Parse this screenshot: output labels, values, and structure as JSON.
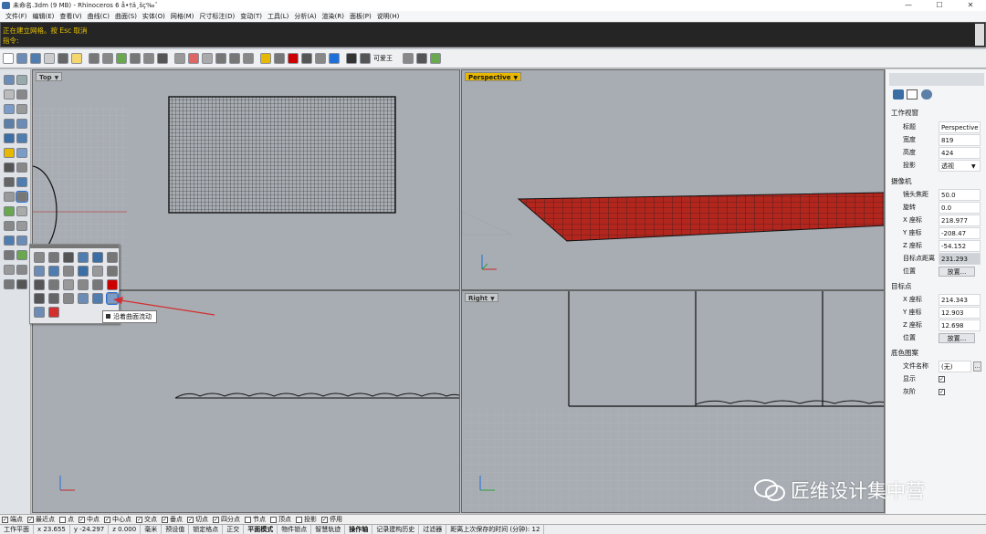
{
  "window": {
    "title": "未命名.3dm (9 MB) - Rhinoceros 6 å•†ä¸šç‰ˆ",
    "min": "—",
    "max": "☐",
    "close": "✕"
  },
  "menu": [
    "文件(F)",
    "编辑(E)",
    "查看(V)",
    "曲线(C)",
    "曲面(S)",
    "实体(O)",
    "网格(M)",
    "尺寸标注(D)",
    "变动(T)",
    "工具(L)",
    "分析(A)",
    "渲染(R)",
    "面板(P)",
    "说明(H)"
  ],
  "command": {
    "history": "正在建立网格。按 Esc 取消",
    "prompt": "指令:"
  },
  "toolbar": {
    "named_label": "可爱王"
  },
  "viewports": {
    "top": "Top",
    "perspective": "Perspective",
    "right": "Right"
  },
  "flyout_tooltip": "沿着曲面流动",
  "panel": {
    "section_viewport": "工作视窗",
    "title_k": "标题",
    "title_v": "Perspective",
    "width_k": "宽度",
    "width_v": "819",
    "height_k": "高度",
    "height_v": "424",
    "proj_k": "投影",
    "proj_v": "透视",
    "section_camera": "摄像机",
    "lens_k": "镜头焦距",
    "lens_v": "50.0",
    "rot_k": "旋转",
    "rot_v": "0.0",
    "cx_k": "X 座标",
    "cx_v": "218.977",
    "cy_k": "Y 座标",
    "cy_v": "-208.47",
    "cz_k": "Z 座标",
    "cz_v": "-54.152",
    "dist_k": "目标点距离",
    "dist_v": "231.293",
    "pos_k": "位置",
    "place_btn": "放置...",
    "section_target": "目标点",
    "tx_k": "X 座标",
    "tx_v": "214.343",
    "ty_k": "Y 座标",
    "ty_v": "12.903",
    "tz_k": "Z 座标",
    "tz_v": "12.698",
    "pos2_k": "位置",
    "place_btn2": "放置...",
    "section_wall": "底色图案",
    "file_k": "文件名称",
    "file_v": "(无)",
    "show_k": "显示",
    "gray_k": "灰阶"
  },
  "osnap": {
    "items": [
      "端点",
      "最近点",
      "点",
      "中点",
      "中心点",
      "交点",
      "垂点",
      "切点",
      "四分点",
      "节点",
      "顶点",
      "投影",
      "停用"
    ],
    "checked": [
      true,
      true,
      false,
      true,
      true,
      true,
      true,
      true,
      true,
      false,
      false,
      false,
      true
    ]
  },
  "status": {
    "cplane": "工作平面",
    "x": "x 23.655",
    "y": "y -24.297",
    "z": "z 0.000",
    "unit": "毫米",
    "layer": "预设值",
    "items": [
      "锁定格点",
      "正交",
      "平面模式",
      "物件锁点",
      "智慧轨迹",
      "操作轴",
      "记录建构历史",
      "过滤器",
      "距离上次保存的时间 (分钟): 12"
    ],
    "on": [
      false,
      false,
      true,
      false,
      false,
      true,
      false,
      false,
      false
    ]
  },
  "watermark": "匠维设计集中营",
  "colors": {
    "viewport": "#a8adb3",
    "active_label": "#e8b800",
    "mesh_red": "#b3261e",
    "command_text": "#e6c200"
  }
}
